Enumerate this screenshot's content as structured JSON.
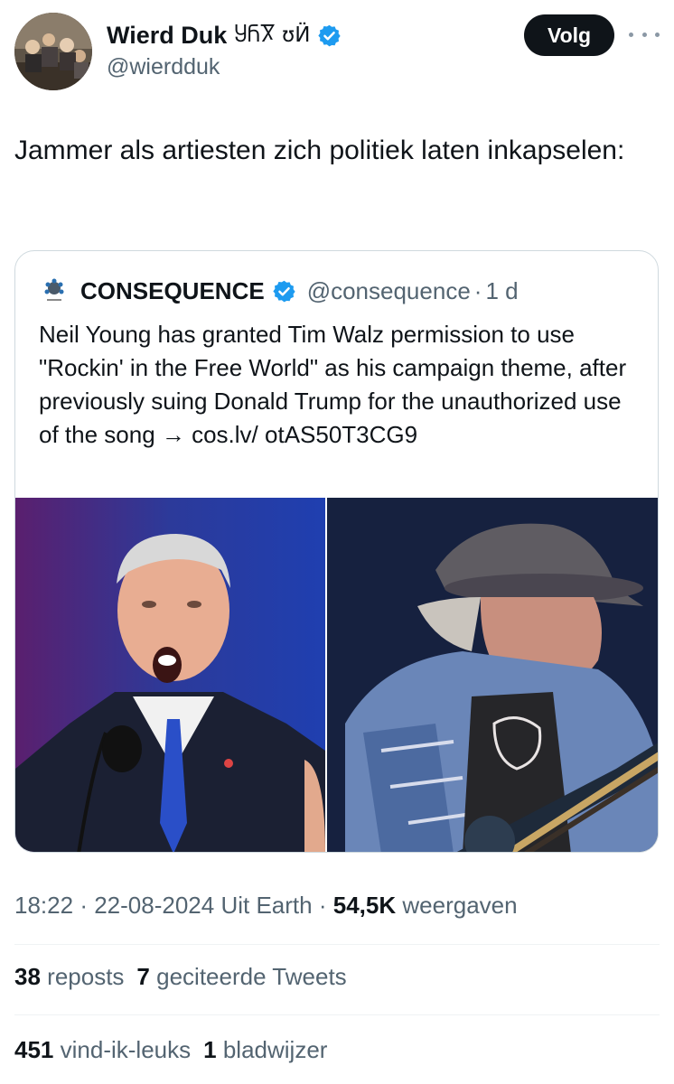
{
  "author": {
    "display_name": "Wierd Duk",
    "script_name": "ႸႬႿ ʊӤ",
    "handle": "@wierdduk"
  },
  "follow_label": "Volg",
  "tweet_text": "Jammer als artiesten zich politiek laten inkapselen:",
  "quote": {
    "name": "CONSEQUENCE",
    "handle": "@consequence",
    "separator": "·",
    "age": "1 d",
    "text": "Neil Young has granted Tim Walz permission to use \"Rockin' in the Free World\" as his campaign theme, after previously suing Donald Trump for the unauthorized use of the song → cos.lv/ otAS50T3CG9"
  },
  "meta": {
    "time": "18:22",
    "dot": "·",
    "date": "22-08-2024",
    "source": "Uit Earth",
    "views_count": "54,5K",
    "views_label": "weergaven"
  },
  "stats": {
    "reposts_count": "38",
    "reposts_label": "reposts",
    "quotes_count": "7",
    "quotes_label": "geciteerde Tweets",
    "likes_count": "451",
    "likes_label": "vind-ik-leuks",
    "bookmarks_count": "1",
    "bookmarks_label": "bladwijzer"
  },
  "icons": {
    "verified": "verified-badge-icon",
    "more": "more-options-icon"
  },
  "colors": {
    "verified_blue": "#1d9bf0",
    "follow_bg": "#0f1419",
    "secondary_text": "#536471"
  }
}
